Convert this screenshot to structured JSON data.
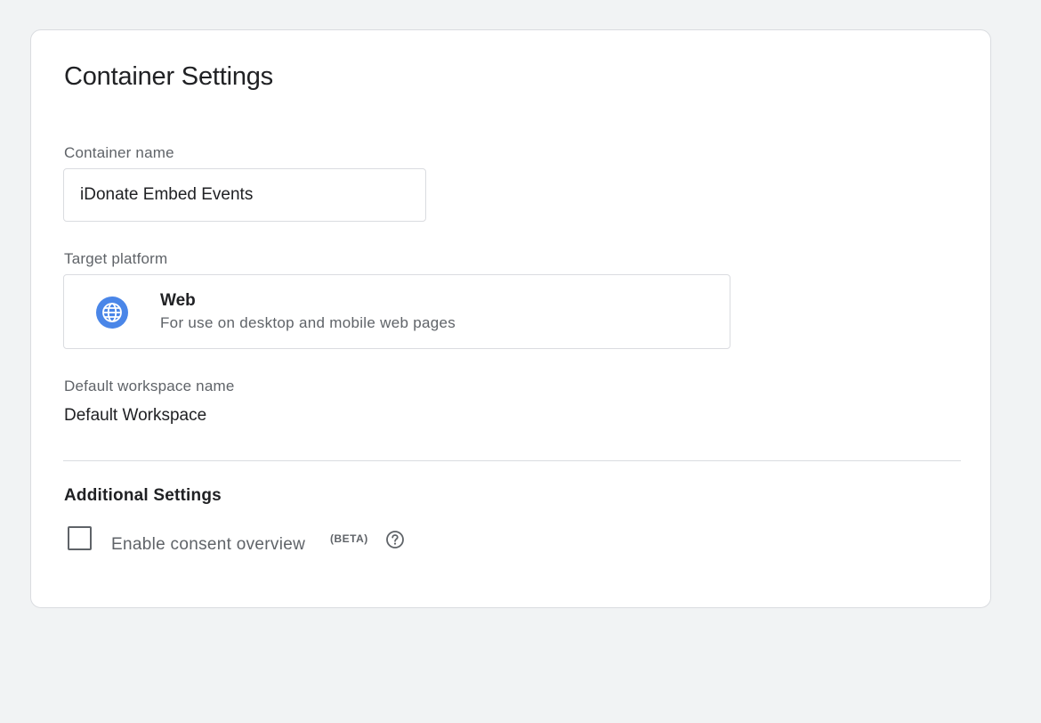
{
  "page": {
    "title": "Container Settings"
  },
  "container_name": {
    "label": "Container name",
    "value": "iDonate Embed Events"
  },
  "target_platform": {
    "label": "Target platform",
    "icon": "globe-icon",
    "name": "Web",
    "description": "For use on desktop and mobile web pages"
  },
  "workspace": {
    "label": "Default workspace name",
    "value": "Default Workspace"
  },
  "additional": {
    "title": "Additional Settings",
    "consent_label": "Enable consent overview",
    "beta_badge": "(BETA)",
    "help_icon": "help-circle-icon",
    "consent_checked": false
  },
  "colors": {
    "background": "#f1f3f4",
    "globe_blue": "#4a86e8",
    "border": "#dadce0",
    "secondary_text": "#5f6368"
  }
}
